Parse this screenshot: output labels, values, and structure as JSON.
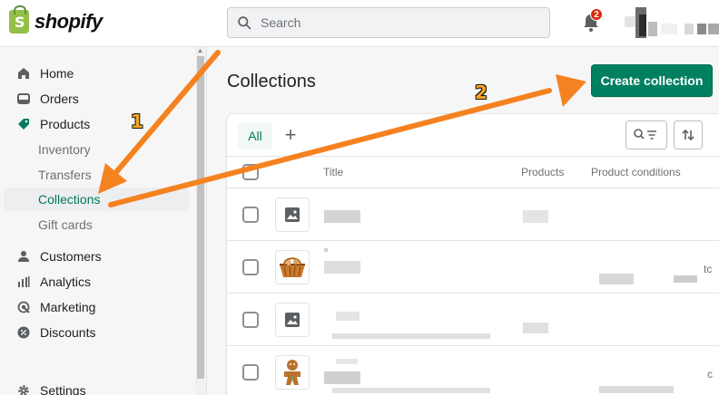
{
  "brand": {
    "name": "shopify",
    "logo_letter": "S",
    "accent": "#008060",
    "logo_green": "#95bf47"
  },
  "search": {
    "placeholder": "Search"
  },
  "notifications": {
    "count": "2"
  },
  "sidebar": {
    "items": [
      {
        "label": "Home",
        "icon": "home-icon"
      },
      {
        "label": "Orders",
        "icon": "inbox-icon"
      },
      {
        "label": "Products",
        "icon": "tag-icon"
      },
      {
        "label": "Inventory"
      },
      {
        "label": "Transfers"
      },
      {
        "label": "Collections",
        "selected": true
      },
      {
        "label": "Gift cards"
      },
      {
        "label": "Customers",
        "icon": "person-icon"
      },
      {
        "label": "Analytics",
        "icon": "bar-chart-icon"
      },
      {
        "label": "Marketing",
        "icon": "target-icon"
      },
      {
        "label": "Discounts",
        "icon": "discount-icon"
      },
      {
        "label": "Settings",
        "icon": "gear-icon"
      }
    ]
  },
  "main": {
    "title": "Collections",
    "create_button": "Create collection",
    "tabs": [
      {
        "label": "All"
      },
      {
        "label": "+"
      }
    ],
    "columns": [
      "Title",
      "Products",
      "Product conditions"
    ],
    "rows": [
      {
        "thumbnail": "image-placeholder-icon",
        "title": "",
        "products": "",
        "conditions": ""
      },
      {
        "thumbnail": "basket-product-image",
        "title": "",
        "products": "",
        "conditions": "",
        "cut_text": "tc"
      },
      {
        "thumbnail": "image-placeholder-icon",
        "title": "",
        "products": "",
        "conditions": ""
      },
      {
        "thumbnail": "gingerbread-product-image",
        "title": "",
        "products": "",
        "conditions": "",
        "cut_text": "c"
      }
    ]
  },
  "annotations": {
    "arrow_1_label": "1",
    "arrow_2_label": "2",
    "arrow_color": "#f58220"
  }
}
